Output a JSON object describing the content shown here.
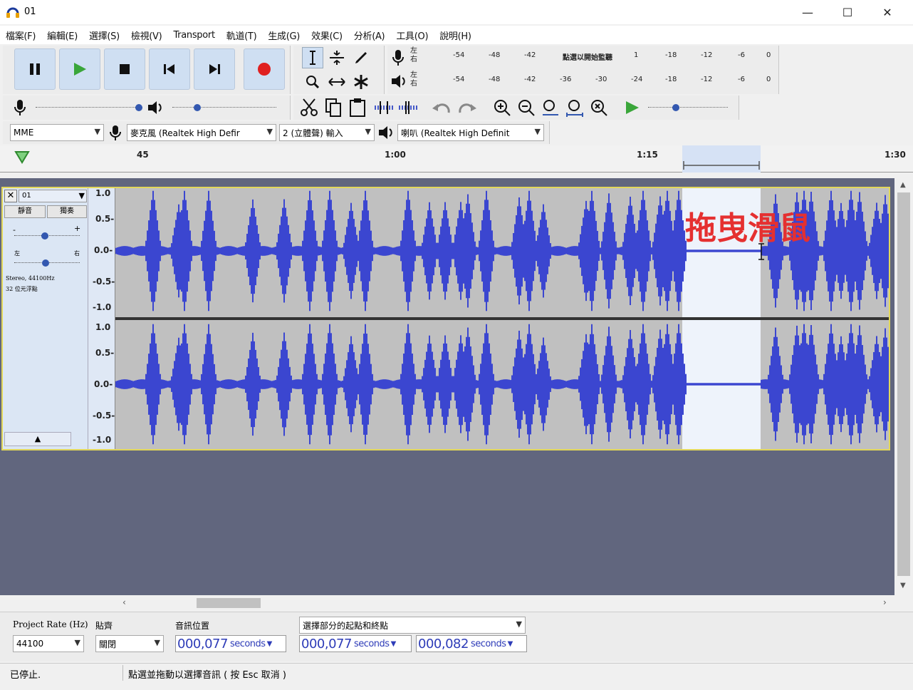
{
  "window": {
    "title": "01"
  },
  "menu": [
    "檔案(F)",
    "編輯(E)",
    "選擇(S)",
    "檢視(V)",
    "Transport",
    "軌道(T)",
    "生成(G)",
    "效果(C)",
    "分析(A)",
    "工具(O)",
    "說明(H)"
  ],
  "meters": {
    "record_lr": "左右",
    "play_lr": "左右",
    "record_ticks": [
      "-54",
      "-48",
      "-42",
      "點選以開始監聽",
      "1",
      "-18",
      "-12",
      "-6",
      "0"
    ],
    "play_ticks": [
      "-54",
      "-48",
      "-42",
      "-36",
      "-30",
      "-24",
      "-18",
      "-12",
      "-6",
      "0"
    ]
  },
  "devices": {
    "host": "MME",
    "input": "麥克風 (Realtek High Defir",
    "channels": "2 (立體聲) 輸入",
    "output": "喇叭 (Realtek High Definit"
  },
  "ruler": {
    "labels": [
      "45",
      "1:00",
      "1:15",
      "1:30"
    ]
  },
  "track": {
    "name": "01",
    "mute": "靜音",
    "solo": "獨奏",
    "pan_left": "左",
    "pan_right": "右",
    "info_line1": "Stereo, 44100Hz",
    "info_line2": "32 位元浮點",
    "scale": [
      "1.0",
      "0.5-",
      "0.0-",
      "-0.5-",
      "-1.0"
    ],
    "annotation": "拖曳滑鼠"
  },
  "selection_bar": {
    "rate_label": "Project Rate (Hz)",
    "rate_value": "44100",
    "snap_label": "貼齊",
    "snap_value": "關閉",
    "pos_label": "音訊位置",
    "pos_value": "000,077",
    "sel_label": "選擇部分的起點和終點",
    "sel_start": "000,077",
    "sel_end": "000,082",
    "unit": "seconds"
  },
  "status": {
    "state": "已停止.",
    "hint": "點選並拖動以選擇音訊 ( 按 Esc 取消 )"
  }
}
